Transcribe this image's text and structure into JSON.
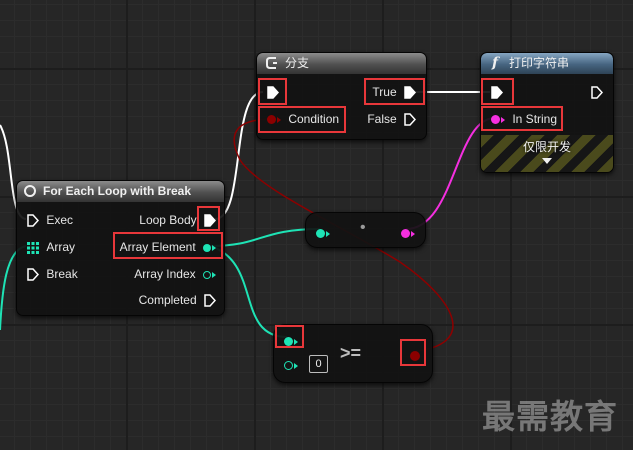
{
  "foreach": {
    "title": "For Each Loop with Break",
    "exec": "Exec",
    "array": "Array",
    "break": "Break",
    "loop_body": "Loop Body",
    "array_element": "Array Element",
    "array_index": "Array Index",
    "completed": "Completed"
  },
  "branch": {
    "title": "分支",
    "true": "True",
    "condition": "Condition",
    "false": "False"
  },
  "printstring": {
    "title": "打印字符串",
    "in_string": "In String",
    "dev_only": "仅限开发"
  },
  "compare": {
    "operator": ">=",
    "value": "0"
  },
  "reroute": {
    "dot": "•"
  },
  "watermark": "最需教育",
  "colors": {
    "exec": "#ffffff",
    "int": "#1ee3b5",
    "bool": "#8c0000",
    "string": "#f52fe0",
    "highlight": "#e8373a"
  }
}
